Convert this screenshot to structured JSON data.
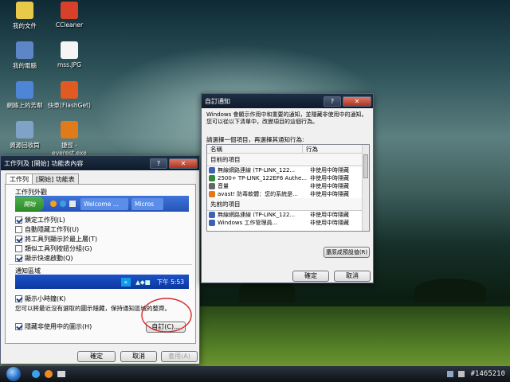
{
  "desktop": {
    "icons": [
      {
        "label": "我的文件",
        "color": "#e9c94a"
      },
      {
        "label": "CCleaner",
        "color": "#d8402a"
      },
      {
        "label": "我的電腦",
        "color": "#5d86c7"
      },
      {
        "label": "mss.JPG",
        "color": "#f5f5f5"
      },
      {
        "label": "網路上的芳鄰",
        "color": "#4f85d6"
      },
      {
        "label": "快車(FlashGet)",
        "color": "#e05a22"
      },
      {
        "label": "資源回收筒",
        "color": "#7fa2c7"
      },
      {
        "label": "捷徑 - everest.exe",
        "color": "#e07b1c"
      }
    ]
  },
  "taskbar_props": {
    "title": "工作列及 [開始] 功能表內容",
    "tabs": [
      "工作列",
      "[開始] 功能表"
    ],
    "group_appearance": "工作列外觀",
    "preview": {
      "start": "開始",
      "btn1": "Welcome ...",
      "btn2": "Micros"
    },
    "options": [
      {
        "label": "鎖定工作列(L)",
        "checked": true
      },
      {
        "label": "自動隱藏工作列(U)",
        "checked": false
      },
      {
        "label": "將工具列顯示於最上層(T)",
        "checked": true
      },
      {
        "label": "類似工具列按鈕分組(G)",
        "checked": false
      },
      {
        "label": "顯示快速啟動(Q)",
        "checked": true
      }
    ],
    "group_notify": "通知區域",
    "clock_preview": "下午 5:53",
    "show_clock": {
      "label": "顯示小時鐘(K)",
      "checked": true
    },
    "notify_desc": "您可以將最近沒有選取的圖示隱藏，保持通知區域的整齊。",
    "hide_inactive": {
      "label": "隱藏非使用中的圖示(H)",
      "checked": true
    },
    "customize": "自訂(C)...",
    "ok": "確定",
    "cancel": "取消",
    "apply": "套用(A)"
  },
  "notify_dialog": {
    "title": "自訂通知",
    "desc": "Windows 會顯示作用中和重要的通知，並隱藏非使用中的通知。您可以從以下清單中，改變項目的這個行為。",
    "instruction": "請選擇一個項目，再選擇其通知行為:",
    "col_name": "名稱",
    "col_behavior": "行為",
    "current_group": "目前的項目",
    "current": [
      {
        "name": "無線網路連線 (TP-LINK_122...",
        "behavior": "非使用中時隱藏",
        "color": "#3a63b8"
      },
      {
        "name": "2500+ TP-LINK_122EF6 Authe...",
        "behavior": "非使用中時隱藏",
        "color": "#2f8a3a"
      },
      {
        "name": "音量",
        "behavior": "非使用中時隱藏",
        "color": "#666"
      },
      {
        "name": "avast! 防毒軟體：您的系統是...",
        "behavior": "非使用中時隱藏",
        "color": "#e07818"
      }
    ],
    "past_group": "先前的項目",
    "past": [
      {
        "name": "無線網路連線 (TP-LINK_122...",
        "behavior": "非使用中時隱藏",
        "color": "#3a63b8"
      },
      {
        "name": "Windows 工作管理員...",
        "behavior": "非使用中時隱藏",
        "color": "#3a63b8"
      }
    ],
    "restore": "還原成預設值(R)",
    "ok": "確定",
    "cancel": "取消"
  },
  "taskbar": {
    "watermark": "#1465210"
  },
  "colors": {
    "annotation": "#d42a2a"
  }
}
